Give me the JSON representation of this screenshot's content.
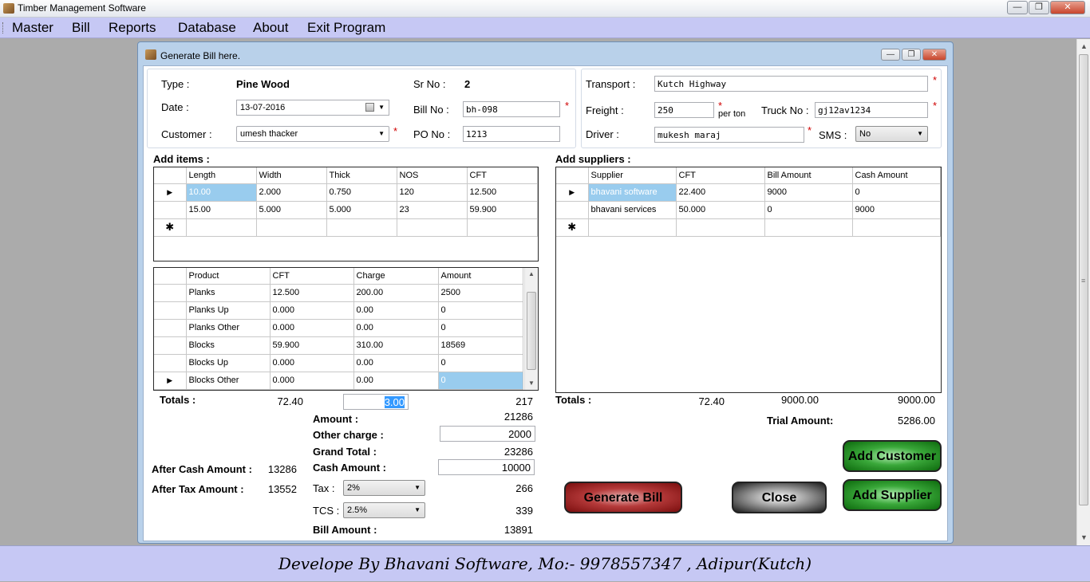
{
  "app": {
    "title": "Timber Management Software"
  },
  "menu": [
    "Master",
    "Bill",
    "Reports",
    "Database",
    "About",
    "Exit Program"
  ],
  "child": {
    "title": "Generate Bill here."
  },
  "header": {
    "type_label": "Type :",
    "type_value": "Pine Wood",
    "date_label": "Date :",
    "date_value": "13-07-2016",
    "customer_label": "Customer :",
    "customer_value": "umesh thacker",
    "srno_label": "Sr No :",
    "srno_value": "2",
    "billno_label": "Bill No :",
    "billno_value": "bh-098",
    "pono_label": "PO No :",
    "pono_value": "1213",
    "transport_label": "Transport :",
    "transport_value": "Kutch Highway",
    "freight_label": "Freight :",
    "freight_value": "250",
    "per_ton": "per ton",
    "truck_label": "Truck No :",
    "truck_value": "gj12av1234",
    "driver_label": "Driver :",
    "driver_value": "mukesh maraj",
    "sms_label": "SMS :",
    "sms_value": "No",
    "star": "*"
  },
  "items": {
    "label": "Add items :",
    "columns": [
      "Length",
      "Width",
      "Thick",
      "NOS",
      "CFT"
    ],
    "rows": [
      [
        "10.00",
        "2.000",
        "0.750",
        "120",
        "12.500"
      ],
      [
        "15.00",
        "5.000",
        "5.000",
        "23",
        "59.900"
      ]
    ]
  },
  "products": {
    "columns": [
      "Product",
      "CFT",
      "Charge",
      "Amount"
    ],
    "rows": [
      [
        "Planks",
        "12.500",
        "200.00",
        "2500"
      ],
      [
        "Planks Up",
        "0.000",
        "0.00",
        "0"
      ],
      [
        "Planks Other",
        "0.000",
        "0.00",
        "0"
      ],
      [
        "Blocks",
        "59.900",
        "310.00",
        "18569"
      ],
      [
        "Blocks Up",
        "0.000",
        "0.00",
        "0"
      ],
      [
        "Blocks Other",
        "0.000",
        "0.00",
        "0"
      ]
    ]
  },
  "suppliers": {
    "label": "Add suppliers :",
    "columns": [
      "Supplier",
      "CFT",
      "Bill Amount",
      "Cash Amount"
    ],
    "rows": [
      [
        "bhavani software",
        "22.400",
        "9000",
        "0"
      ],
      [
        "bhavani services",
        "50.000",
        "0",
        "9000"
      ]
    ]
  },
  "totals_left": {
    "label": "Totals :",
    "cft": "72.40",
    "charge": "3.00",
    "amount": "217",
    "amount_label": "Amount :",
    "amount_value": "21286",
    "other_label": "Other charge :",
    "other_value": "2000",
    "grand_label": "Grand Total :",
    "grand_value": "23286",
    "cash_label": "Cash Amount :",
    "cash_value": "10000",
    "tax_label": "Tax  :",
    "tax_option": "2%",
    "tax_value": "266",
    "tcs_label": "TCS :",
    "tcs_option": "2.5%",
    "tcs_value": "339",
    "bill_label": "Bill Amount :",
    "bill_value": "13891",
    "after_cash_label": "After Cash Amount :",
    "after_cash_value": "13286",
    "after_tax_label": "After Tax Amount :",
    "after_tax_value": "13552"
  },
  "totals_right": {
    "label": "Totals :",
    "cft": "72.40",
    "bill": "9000.00",
    "cash": "9000.00",
    "trial_label": "Trial Amount:",
    "trial_value": "5286.00"
  },
  "buttons": {
    "generate": "Generate Bill",
    "close": "Close",
    "add_customer": "Add Customer",
    "add_supplier": "Add Supplier"
  },
  "footer": "Develope By Bhavani Software, Mo:- 9978557347 , Adipur(Kutch)"
}
